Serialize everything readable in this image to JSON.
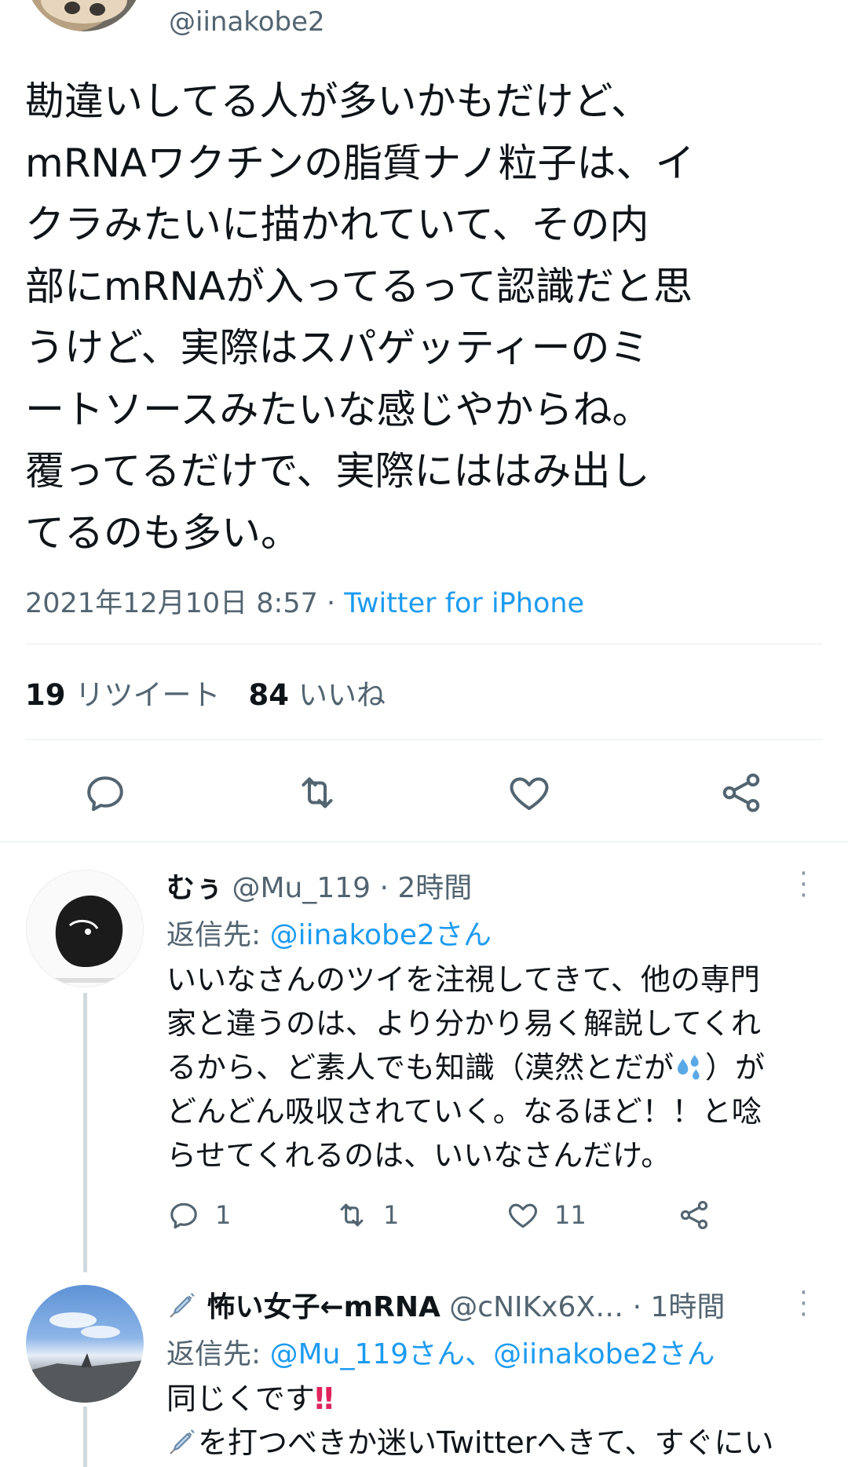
{
  "top": {
    "handle": "@iinakobe2"
  },
  "tweet": {
    "text": "勘違いしてる人が多いかもだけど、\nmRNAワクチンの脂質ナノ粒子は、イ\nクラみたいに描かれていて、その内\n部にmRNAが入ってるって認識だと思\nうけど、実際はスパゲッティーのミ\nートソースみたいな感じやからね。\n覆ってるだけで、実際にははみ出し\nてるのも多い。",
    "date": "2021年12月10日 8:57",
    "separator": " · ",
    "source": "Twitter for iPhone",
    "retweets": "19",
    "retweets_label": "リツイート",
    "likes": "84",
    "likes_label": "いいね"
  },
  "replies": [
    {
      "name": "むぅ",
      "handle": "@Mu_119",
      "time": "2時間",
      "reply_to_prefix": "返信先: ",
      "reply_to": "@iinakobe2さん",
      "body_1": "いいなさんのツイを注視してきて、他の専門\n家と違うのは、より分かり易く解説してくれ\nるから、ど素人でも知識（漠然とだが",
      "body_2": "）が\nどんどん吸収されていく。なるほど！！と唸\nらせてくれるのは、いいなさんだけ。",
      "reply_count": "1",
      "retweet_count": "1",
      "like_count": "11"
    },
    {
      "name": "怖い女子←mRNA",
      "handle": "@cNIKx6X…",
      "time": "1時間",
      "reply_to_prefix": "返信先: ",
      "reply_to": "@Mu_119さん、@iinakobe2さん",
      "body_line1": "同じくです",
      "body_line1_emoji": "‼",
      "body_line2": "を打つべきか迷いTwitterへきて、すぐにい"
    }
  ],
  "icons": {
    "reply": "reply-icon",
    "retweet": "retweet-icon",
    "like": "heart-icon",
    "share": "share-icon",
    "more": "more-icon",
    "syringe": "syringe-icon",
    "sweat_drops": "sweat-drops-icon"
  },
  "colors": {
    "text": "#0f1419",
    "secondary": "#536471",
    "link": "#1d9bf0",
    "divider": "#e6ecf0"
  }
}
